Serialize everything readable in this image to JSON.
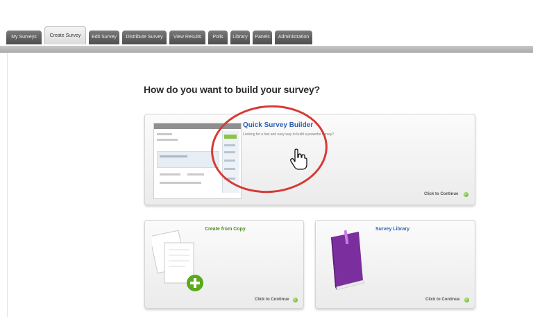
{
  "tabs": [
    {
      "label": "My Surveys",
      "active": false
    },
    {
      "label": "Create Survey",
      "active": true
    },
    {
      "label": "Edit Survey",
      "active": false
    },
    {
      "label": "Distribute Survey",
      "active": false
    },
    {
      "label": "View Results",
      "active": false
    },
    {
      "label": "Polls",
      "active": false
    },
    {
      "label": "Library",
      "active": false
    },
    {
      "label": "Panels",
      "active": false
    },
    {
      "label": "Administration",
      "active": false
    }
  ],
  "heading": "How do you want to build your survey?",
  "cards": {
    "quick": {
      "title": "Quick Survey Builder",
      "desc_line1": "Looking for a fast and easy way to build a powerful survey?",
      "desc_line2": "",
      "continue": "Click to Continue"
    },
    "copy": {
      "title": "Create from Copy",
      "desc": "",
      "continue": "Click to Continue"
    },
    "library": {
      "title": "Survey Library",
      "desc": "",
      "continue": "Click to Continue"
    }
  },
  "colors": {
    "card_title_blue": "#2f5fb0",
    "card_title_green": "#4d8a1c",
    "highlight_ring": "#d63a35",
    "tab_bg": "#5f5f5f",
    "book_purple": "#7b2f9e"
  },
  "icons": {
    "continue": "green-arrow-circle-icon",
    "copy": "documents-copy-icon",
    "library": "purple-book-icon",
    "cursor": "hand-pointer-icon"
  }
}
